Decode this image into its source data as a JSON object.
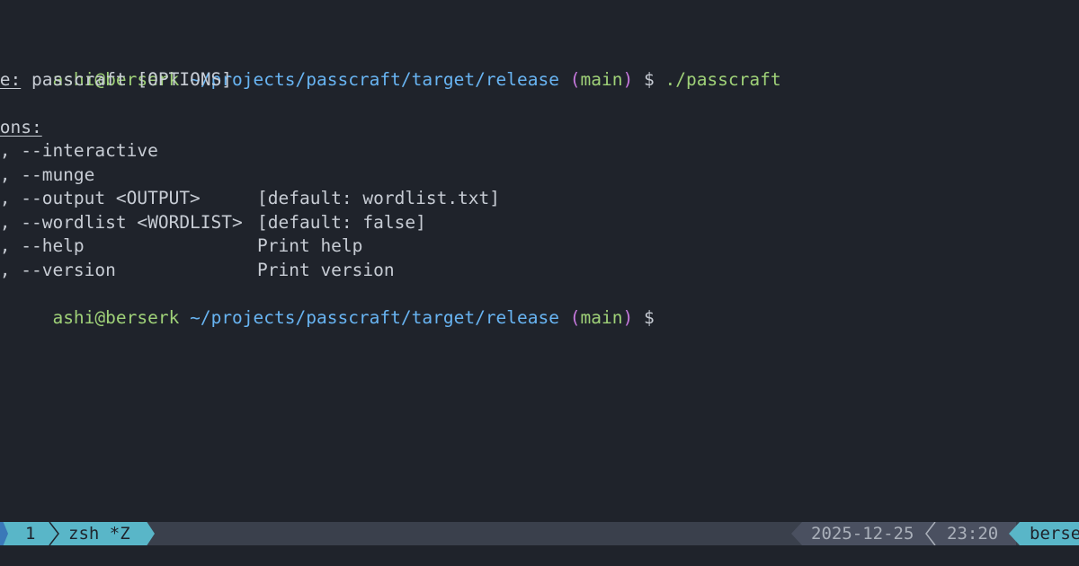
{
  "terminal": {
    "prompt": {
      "user_host": "ashi@berserk",
      "path": "~/projects/passcraft/target/release",
      "paren_open": "(",
      "branch": "main",
      "paren_close": ")",
      "dollar": "$"
    },
    "command": "./passcraft",
    "usage_label": "ge:",
    "usage_rest": " passcraft [OPTIONS]",
    "options_header": "ions:",
    "options": [
      {
        "flag": "i, --interactive",
        "desc": ""
      },
      {
        "flag": "m, --munge",
        "desc": ""
      },
      {
        "flag": "o, --output <OUTPUT>",
        "desc": "[default: wordlist.txt]"
      },
      {
        "flag": "w, --wordlist <WORDLIST>",
        "desc": "[default: false]"
      },
      {
        "flag": "h, --help",
        "desc": "Print help"
      },
      {
        "flag": "V, --version",
        "desc": "Print version"
      }
    ]
  },
  "statusbar": {
    "window_index": "1",
    "window_name": "zsh *Z",
    "date": "2025-12-25",
    "time": "23:20",
    "host": "berse"
  },
  "colors": {
    "background": "#1f232b",
    "user": "#9fd178",
    "path": "#68b4f2",
    "paren": "#c678dd",
    "status_accent": "#59b6c8"
  }
}
